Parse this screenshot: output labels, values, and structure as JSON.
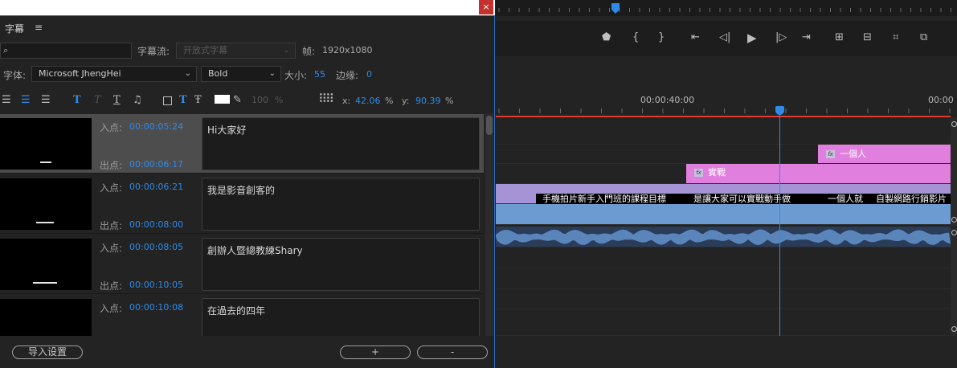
{
  "window": {
    "close_glyph": "×"
  },
  "panel": {
    "tab_title": "字幕",
    "menu_glyph": "≡"
  },
  "search": {
    "value": "",
    "placeholder": ""
  },
  "stream": {
    "label": "字幕流:",
    "value": "开放式字幕",
    "frame_label": "帧:",
    "frame_value": "1920x1080"
  },
  "font": {
    "label": "字体:",
    "family": "Microsoft JhengHei",
    "style": "Bold",
    "size_label": "大小:",
    "size_value": "55",
    "margin_label": "边缘:",
    "margin_value": "0"
  },
  "toolbar": {
    "opacity_value": "100",
    "opacity_unit": "%",
    "x_label": "x:",
    "x_value": "42.06",
    "x_unit": "%",
    "y_label": "y:",
    "y_value": "90.39",
    "y_unit": "%"
  },
  "captions": [
    {
      "in_label": "入点:",
      "in_time": "00:00:05:24",
      "out_label": "出点:",
      "out_time": "00:00:06:17",
      "text": "Hi大家好"
    },
    {
      "in_label": "入点:",
      "in_time": "00:00:06:21",
      "out_label": "出点:",
      "out_time": "00:00:08:00",
      "text": "我是影音創客的"
    },
    {
      "in_label": "入点:",
      "in_time": "00:00:08:05",
      "out_label": "出点:",
      "out_time": "00:00:10:05",
      "text": "創辦人暨總教練Shary"
    },
    {
      "in_label": "入点:",
      "in_time": "00:00:10:08",
      "out_label": "",
      "out_time": "",
      "text": "在過去的四年"
    }
  ],
  "footer": {
    "import_label": "导入设置",
    "add_label": "+",
    "remove_label": "-"
  },
  "timeline": {
    "timecode_1": "00:00:40:00",
    "timecode_2": "00:00",
    "clips": {
      "title_1": "一個人",
      "title_2": "實戰",
      "sub_1": "手機拍片新手入門班的課程目標",
      "sub_2": "是讓大家可以實戰動手做",
      "sub_3": "一個人就",
      "sub_4": "自製網路行銷影片"
    },
    "fx_label": "fx"
  },
  "colors": {
    "accent": "#2d8ceb",
    "title_clip": "#e07fdd",
    "caption_clip": "#a593d6",
    "video_clip": "#6b9bd1",
    "audio_clip": "#5a85bb",
    "playhead": "#2d8ceb",
    "in_out_line": "#e03a31"
  }
}
